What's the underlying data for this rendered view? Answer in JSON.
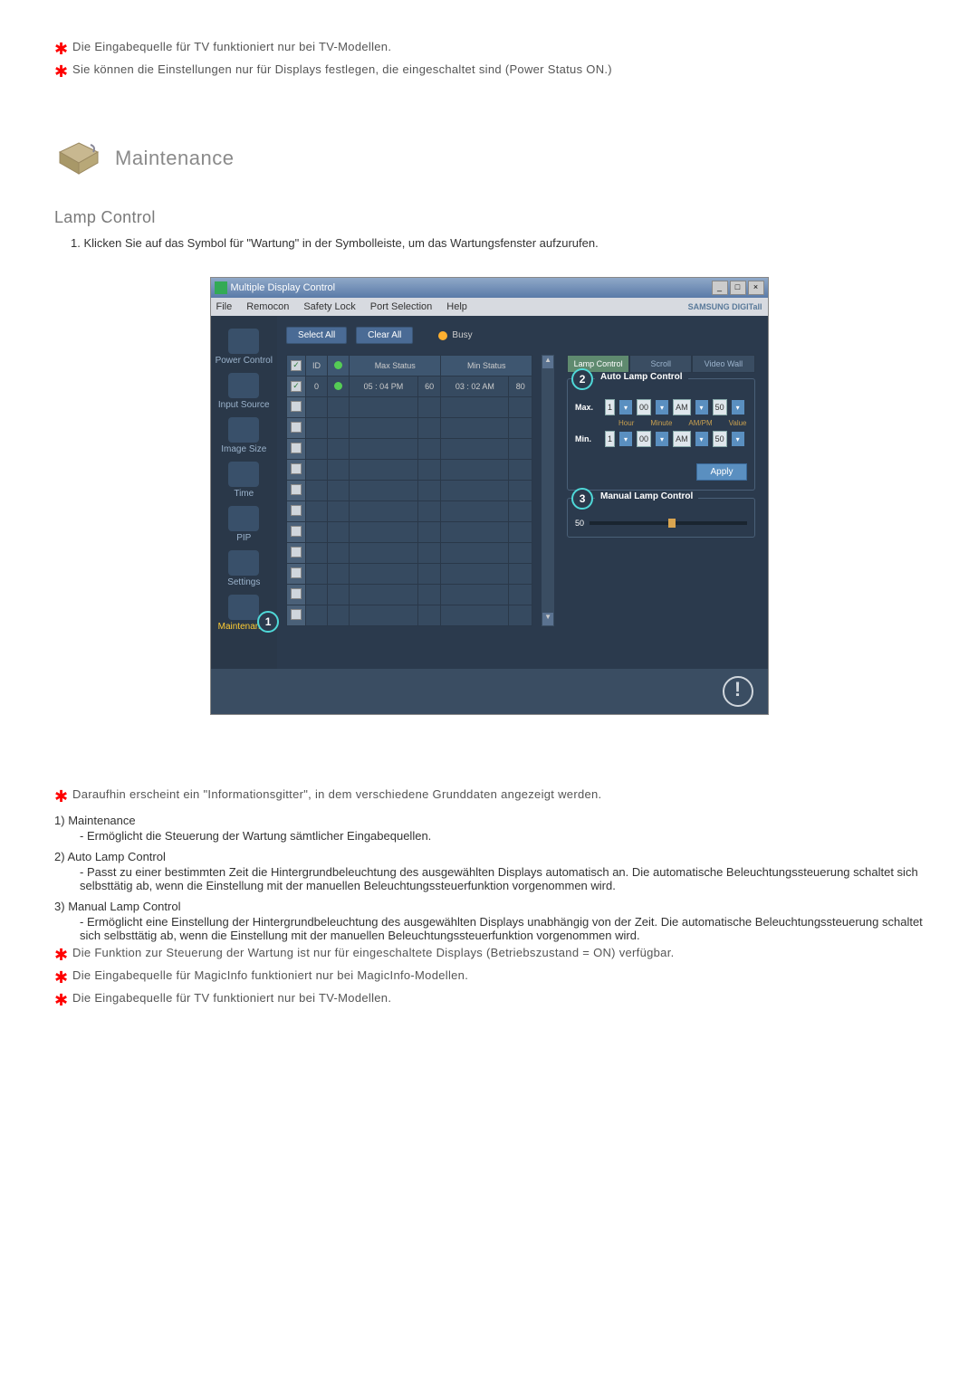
{
  "notes_top": [
    "Die Eingabequelle für TV funktioniert nur bei TV-Modellen.",
    "Sie können die Einstellungen nur für Displays festlegen, die eingeschaltet sind (Power Status ON.)"
  ],
  "section": {
    "title": "Maintenance"
  },
  "subsection": {
    "title": "Lamp Control",
    "intro_num": "1.",
    "intro_text": "Klicken Sie auf das Symbol für \"Wartung\" in der Symbolleiste, um das Wartungsfenster aufzurufen."
  },
  "app": {
    "title": "Multiple Display Control",
    "menu": [
      "File",
      "Remocon",
      "Safety Lock",
      "Port Selection",
      "Help"
    ],
    "brand": "SAMSUNG DIGITall",
    "buttons": {
      "select_all": "Select All",
      "clear_all": "Clear All",
      "busy": "Busy"
    },
    "sidebar": [
      {
        "label": "Power Control"
      },
      {
        "label": "Input Source"
      },
      {
        "label": "Image Size"
      },
      {
        "label": "Time"
      },
      {
        "label": "PIP"
      },
      {
        "label": "Settings"
      },
      {
        "label": "Maintenance"
      }
    ],
    "callouts": {
      "c1": "1",
      "c2": "2",
      "c3": "3"
    },
    "grid": {
      "headers": {
        "chk": "☑",
        "id": "ID",
        "dot": "●",
        "max_status": "Max Status",
        "max_val": "",
        "min_status": "Min Status",
        "min_val": ""
      },
      "row": {
        "id": "0",
        "max_time": "05 : 04 PM",
        "max_val": "60",
        "min_time": "03 : 02 AM",
        "min_val": "80"
      }
    },
    "tabs": {
      "lamp": "Lamp Control",
      "scroll": "Scroll",
      "video": "Video Wall"
    },
    "auto": {
      "title": "Auto Lamp Control",
      "max": "Max.",
      "min": "Min.",
      "hour_val": "1",
      "minute_val": "00",
      "ampm_val": "AM",
      "value_val": "50",
      "sub": {
        "hour": "Hour",
        "minute": "Minute",
        "ampm": "AM/PM",
        "value": "Value"
      },
      "apply": "Apply"
    },
    "manual": {
      "title": "Manual Lamp Control",
      "value": "50"
    }
  },
  "desc": {
    "intro": "Daraufhin erscheint ein \"Informationsgitter\", in dem verschiedene Grunddaten angezeigt werden.",
    "items": [
      {
        "num": "1)",
        "title": "Maintenance",
        "lines": [
          "- Ermöglicht die Steuerung der Wartung sämtlicher Eingabequellen."
        ]
      },
      {
        "num": "2)",
        "title": "Auto Lamp Control",
        "lines": [
          "- Passt zu einer bestimmten Zeit die Hintergrundbeleuchtung des ausgewählten Displays automatisch an. Die automatische Beleuchtungssteuerung schaltet sich selbsttätig ab, wenn die Einstellung mit der manuellen Beleuchtungssteuerfunktion vorgenommen wird."
        ]
      },
      {
        "num": "3)",
        "title": "Manual Lamp Control",
        "lines": [
          "- Ermöglicht eine Einstellung der Hintergrundbeleuchtung des ausgewählten Displays unabhängig von der Zeit. Die automatische Beleuchtungssteuerung schaltet sich selbsttätig ab, wenn die Einstellung mit der manuellen Beleuchtungssteuerfunktion vorgenommen wird."
        ]
      }
    ]
  },
  "notes_bottom": [
    "Die Funktion zur Steuerung der Wartung ist nur für eingeschaltete Displays (Betriebszustand = ON) verfügbar.",
    "Die Eingabequelle für MagicInfo funktioniert nur bei MagicInfo-Modellen.",
    "Die Eingabequelle für TV funktioniert nur bei TV-Modellen."
  ]
}
